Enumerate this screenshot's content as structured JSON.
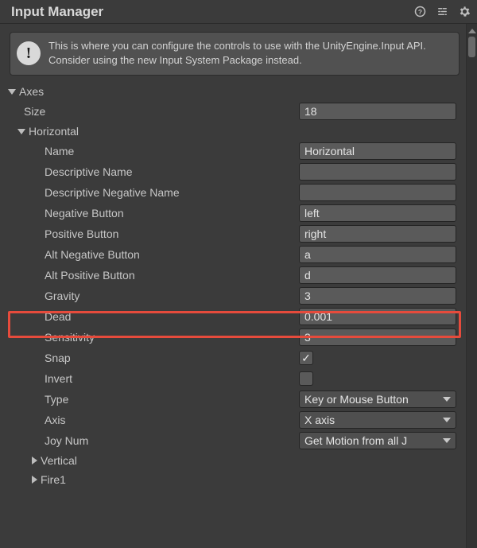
{
  "title": "Input Manager",
  "info_text": "This is where you can configure the controls to use with the UnityEngine.Input API. Consider using the new Input System Package instead.",
  "axes_label": "Axes",
  "size_label": "Size",
  "size_value": "18",
  "horizontal_label": "Horizontal",
  "props": {
    "name": {
      "label": "Name",
      "value": "Horizontal"
    },
    "descName": {
      "label": "Descriptive Name",
      "value": ""
    },
    "descNegName": {
      "label": "Descriptive Negative Name",
      "value": ""
    },
    "negButton": {
      "label": "Negative Button",
      "value": "left"
    },
    "posButton": {
      "label": "Positive Button",
      "value": "right"
    },
    "altNegButton": {
      "label": "Alt Negative Button",
      "value": "a"
    },
    "altPosButton": {
      "label": "Alt Positive Button",
      "value": "d"
    },
    "gravity": {
      "label": "Gravity",
      "value": "3"
    },
    "dead": {
      "label": "Dead",
      "value": "0.001"
    },
    "sensitivity": {
      "label": "Sensitivity",
      "value": "3"
    },
    "snap": {
      "label": "Snap",
      "checked": true
    },
    "invert": {
      "label": "Invert",
      "checked": false
    },
    "type": {
      "label": "Type",
      "value": "Key or Mouse Button"
    },
    "axis": {
      "label": "Axis",
      "value": "X axis"
    },
    "joyNum": {
      "label": "Joy Num",
      "value": "Get Motion from all J"
    }
  },
  "collapsed_axes": [
    "Vertical",
    "Fire1"
  ],
  "highlighted_property": "gravity"
}
